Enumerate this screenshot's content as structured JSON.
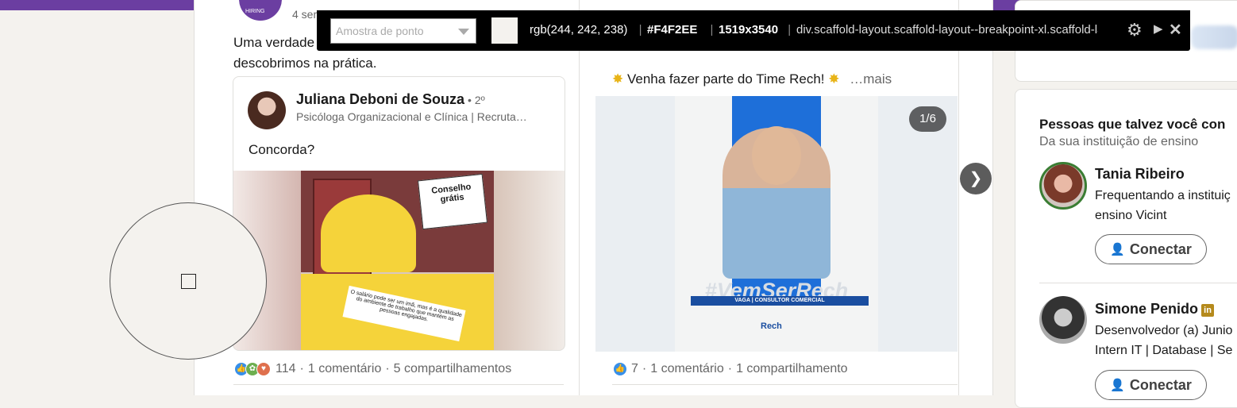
{
  "left_post": {
    "time": "4 sem",
    "avatar_text": "HIRING",
    "text": "Uma verdade que descobrimos na prática.",
    "text_line1": "Uma verdade",
    "text_line2": "descobrimos na prática.",
    "shared": {
      "author": "Juliana Deboni de Souza",
      "degree": "• 2º",
      "headline": "Psicóloga Organizacional e Clínica | Recruta…",
      "text": "Concorda?",
      "meme_sign": "Conselho grátis",
      "meme_paper": "O salário pode ser um imã, mas é a qualidade do ambiente de trabalho que mantém as pessoas engajadas."
    },
    "reactions_count": "114",
    "comments": "1 comentário",
    "shares": "5 compartilhamentos",
    "dot": "·"
  },
  "right_post": {
    "text": "Venha fazer parte do Time Rech!",
    "more": "…mais",
    "counter": "1/6",
    "poster_hashtag": "#VemSerRech",
    "poster_band": "VAGA | CONSULTOR COMERCIAL",
    "poster_logo": "Rech",
    "next": "❯",
    "reactions_count": "7",
    "comments": "1 comentário",
    "shares": "1 compartilhamento",
    "dot": "·"
  },
  "sidebar": {
    "title": "Pessoas que talvez você con",
    "subtitle": "Da sua instituição de ensino",
    "people": [
      {
        "name": "Tania Ribeiro",
        "desc_line1": "Frequentando a instituiç",
        "desc_line2": "ensino Vicint",
        "button": "Conectar"
      },
      {
        "name": "Simone Penido",
        "badge": "in",
        "desc_line1": "Desenvolvedor (a) Junio",
        "desc_line2": "Intern IT | Database | Se",
        "button": "Conectar"
      }
    ]
  },
  "picker": {
    "select_placeholder": "Amostra de ponto",
    "rgb": "rgb(244, 242, 238)",
    "hex": "#F4F2EE",
    "size": "1519x3540",
    "selector": "div.scaffold-layout.scaffold-layout--breakpoint-xl.scaffold-lay",
    "sep": "|",
    "swatch_color": "#F4F2EE"
  }
}
